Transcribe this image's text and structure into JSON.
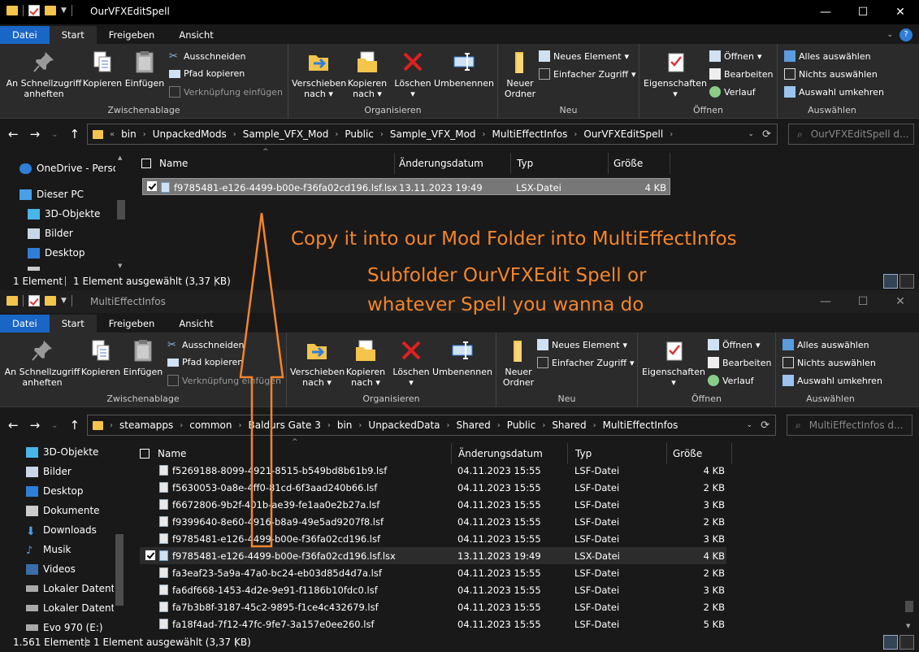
{
  "windows": [
    {
      "title": "OurVFXEditSpell",
      "tabs": [
        "Datei",
        "Start",
        "Freigeben",
        "Ansicht"
      ],
      "ribbon": {
        "clipboard": {
          "label": "Zwischenablage",
          "pin": "An Schnellzugriff anheften",
          "copy": "Kopieren",
          "paste": "Einfügen",
          "cut": "Ausschneiden",
          "copy_path": "Pfad kopieren",
          "paste_link": "Verknüpfung einfügen"
        },
        "organize": {
          "label": "Organisieren",
          "move": "Verschieben nach",
          "copyto": "Kopieren nach",
          "delete": "Löschen",
          "rename": "Umbenennen"
        },
        "new": {
          "label": "Neu",
          "folder": "Neuer Ordner",
          "new_item": "Neues Element",
          "easy_access": "Einfacher Zugriff"
        },
        "open": {
          "label": "Öffnen",
          "props": "Eigenschaften",
          "open": "Öffnen",
          "edit": "Bearbeiten",
          "history": "Verlauf"
        },
        "select": {
          "label": "Auswählen",
          "all": "Alles auswählen",
          "none": "Nichts auswählen",
          "invert": "Auswahl umkehren"
        }
      },
      "path": [
        "bin",
        "UnpackedMods",
        "Sample_VFX_Mod",
        "Public",
        "Sample_VFX_Mod",
        "MultiEffectInfos",
        "OurVFXEditSpell"
      ],
      "path_prefix": "«",
      "search_placeholder": "OurVFXEditSpell d...",
      "nav": [
        "OneDrive - Persor",
        "Dieser PC",
        "3D-Objekte",
        "Bilder",
        "Desktop"
      ],
      "columns": [
        "Name",
        "Änderungsdatum",
        "Typ",
        "Größe"
      ],
      "files": [
        {
          "name": "f9785481-e126-4499-b00e-f36fa02cd196.lsf.lsx",
          "date": "13.11.2023 19:49",
          "type": "LSX-Datei",
          "size": "4 KB"
        }
      ],
      "status": {
        "count": "1 Element",
        "selected": "1 Element ausgewählt (3,37 KB)"
      }
    },
    {
      "title": "MultiEffectInfos",
      "tabs": [
        "Datei",
        "Start",
        "Freigeben",
        "Ansicht"
      ],
      "path": [
        "steamapps",
        "common",
        "Baldurs Gate 3",
        "bin",
        "UnpackedData",
        "Shared",
        "Public",
        "Shared",
        "MultiEffectInfos"
      ],
      "search_placeholder": "MultiEffectInfos d...",
      "nav": [
        "3D-Objekte",
        "Bilder",
        "Desktop",
        "Dokumente",
        "Downloads",
        "Musik",
        "Videos",
        "Lokaler Datenträ",
        "Lokaler Datenträ",
        "Evo 970 (E:)"
      ],
      "columns": [
        "Name",
        "Änderungsdatum",
        "Typ",
        "Größe"
      ],
      "files": [
        {
          "name": "f5269188-8099-4921-8515-b549bd8b61b9.lsf",
          "date": "04.11.2023 15:55",
          "type": "LSF-Datei",
          "size": "4 KB"
        },
        {
          "name": "f5630053-0a8e-4ff0-81cd-6f3aad240b66.lsf",
          "date": "04.11.2023 15:55",
          "type": "LSF-Datei",
          "size": "2 KB"
        },
        {
          "name": "f6672806-9b2f-401b-ae39-fe1aa0e2b27a.lsf",
          "date": "04.11.2023 15:55",
          "type": "LSF-Datei",
          "size": "3 KB"
        },
        {
          "name": "f9399640-8e60-4916-b8a9-49e5ad9207f8.lsf",
          "date": "04.11.2023 15:55",
          "type": "LSF-Datei",
          "size": "2 KB"
        },
        {
          "name": "f9785481-e126-4499-b00e-f36fa02cd196.lsf",
          "date": "04.11.2023 15:55",
          "type": "LSF-Datei",
          "size": "3 KB"
        },
        {
          "name": "f9785481-e126-4499-b00e-f36fa02cd196.lsf.lsx",
          "date": "13.11.2023 19:49",
          "type": "LSX-Datei",
          "size": "4 KB"
        },
        {
          "name": "fa3eaf23-5a9a-47a0-bc24-eb03d85d4d7a.lsf",
          "date": "04.11.2023 15:55",
          "type": "LSF-Datei",
          "size": "2 KB"
        },
        {
          "name": "fa6df668-1453-4d2e-9e91-f1186b10fdc0.lsf",
          "date": "04.11.2023 15:55",
          "type": "LSF-Datei",
          "size": "3 KB"
        },
        {
          "name": "fa7b3b8f-3187-45c2-9895-f1ce4c432679.lsf",
          "date": "04.11.2023 15:55",
          "type": "LSF-Datei",
          "size": "2 KB"
        },
        {
          "name": "fa18f4ad-7f12-47fc-9fe7-3a157e0ee260.lsf",
          "date": "04.11.2023 15:55",
          "type": "LSF-Datei",
          "size": "5 KB"
        }
      ],
      "status": {
        "count": "1.561 Elemente",
        "selected": "1 Element ausgewählt (3,37 KB)"
      }
    }
  ],
  "annotation": {
    "line1": "Copy it into our Mod Folder into MultiEffectInfos",
    "line2": "Subfolder OurVFXEdit Spell or",
    "line3": "whatever Spell you wanna do",
    "color": "#f5852a"
  },
  "colors": {
    "accent": "#1a66c6",
    "bg": "#191919",
    "ribbon": "#2b2b2b",
    "folder": "#f4c44d"
  }
}
